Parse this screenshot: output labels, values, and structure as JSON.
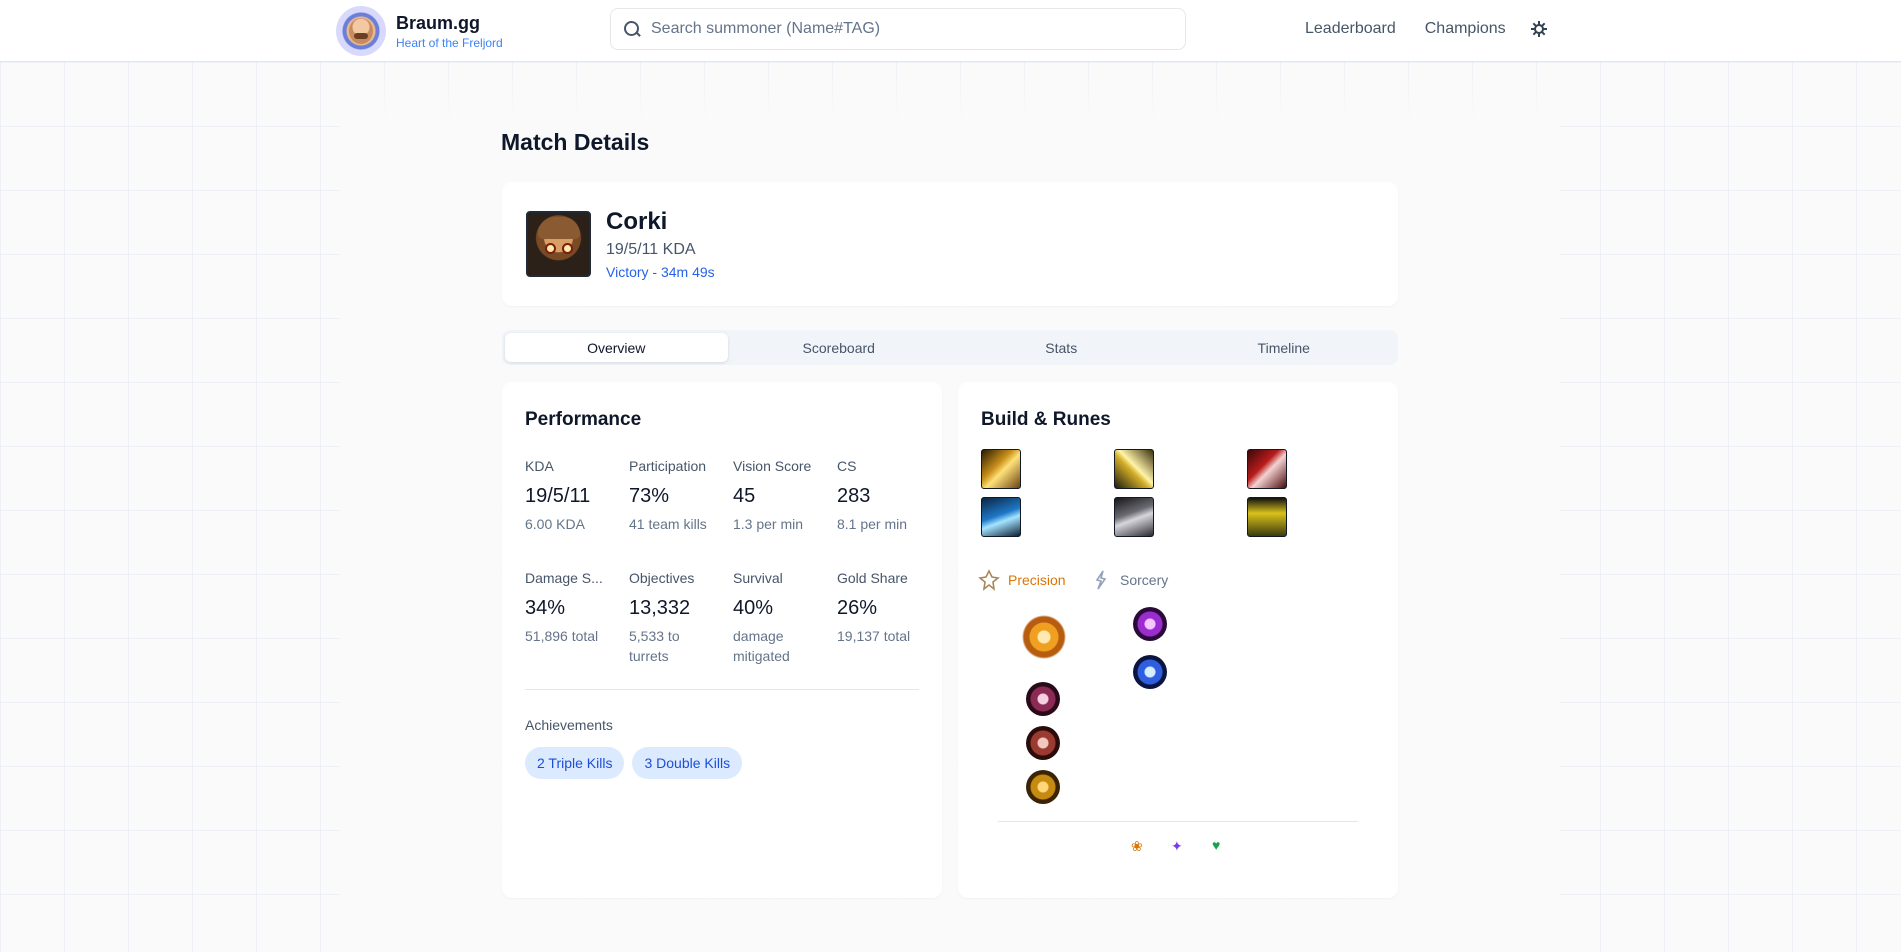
{
  "header": {
    "brand_name": "Braum.gg",
    "brand_sub": "Heart of the Freljord",
    "search_placeholder": "Search summoner (Name#TAG)",
    "nav": [
      "Leaderboard",
      "Champions"
    ]
  },
  "page_title": "Match Details",
  "hero": {
    "champion": "Corki",
    "kda": "19/5/11 KDA",
    "result": "Victory - 34m 49s"
  },
  "tabs": [
    "Overview",
    "Scoreboard",
    "Stats",
    "Timeline"
  ],
  "active_tab": "Overview",
  "performance": {
    "title": "Performance",
    "stats": [
      {
        "label": "KDA",
        "value": "19/5/11",
        "sub": "6.00 KDA"
      },
      {
        "label": "Participation",
        "value": "73%",
        "sub": "41 team kills"
      },
      {
        "label": "Vision Score",
        "value": "45",
        "sub": "1.3 per min"
      },
      {
        "label": "CS",
        "value": "283",
        "sub": "8.1 per min"
      },
      {
        "label": "Damage S...",
        "value": "34%",
        "sub": "51,896 total"
      },
      {
        "label": "Objectives",
        "value": "13,332",
        "sub": "5,533 to turrets"
      },
      {
        "label": "Survival",
        "value": "40%",
        "sub": "damage mitigated"
      },
      {
        "label": "Gold Share",
        "value": "26%",
        "sub": "19,137 total"
      }
    ],
    "achievements_label": "Achievements",
    "achievements": [
      "2 Triple Kills",
      "3 Double Kills"
    ]
  },
  "build": {
    "title": "Build & Runes",
    "items": [
      "item-1-icon",
      "item-2-icon",
      "item-3-icon",
      "item-4-icon",
      "item-5-icon",
      "item-6-icon"
    ],
    "primary_tree": "Precision",
    "secondary_tree": "Sorcery",
    "primary_color": "#d97706",
    "secondary_color": "#64748b",
    "shards": [
      "❀",
      "✦",
      "♥"
    ]
  }
}
